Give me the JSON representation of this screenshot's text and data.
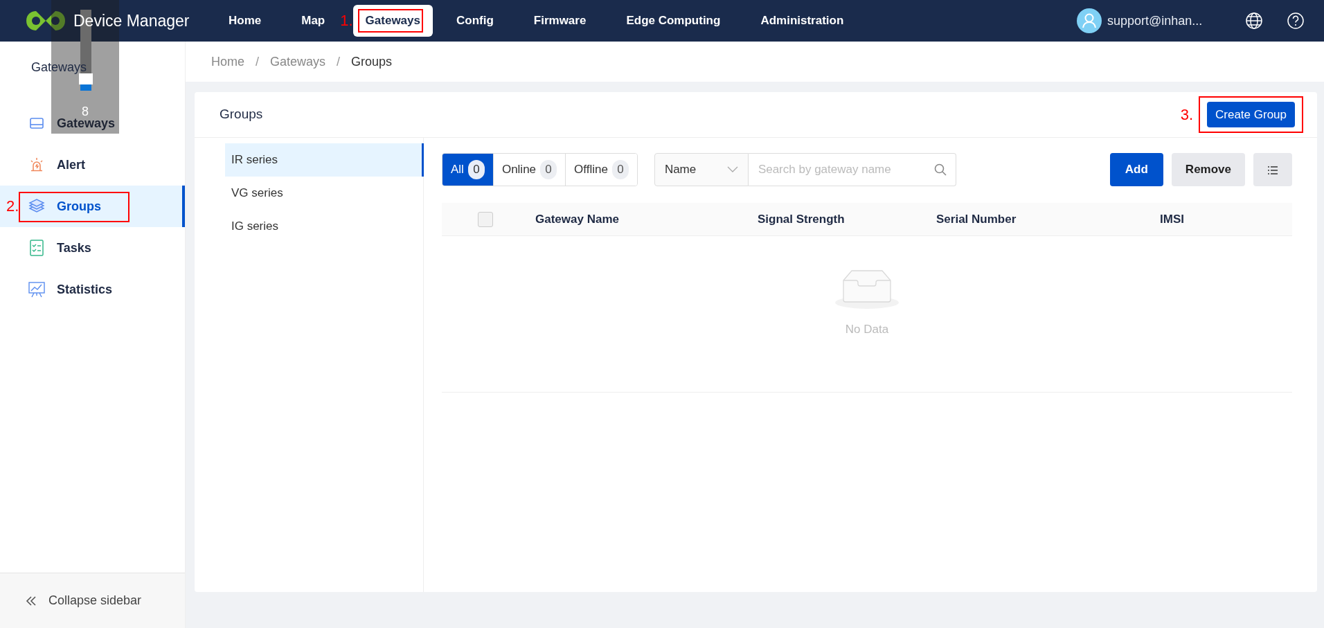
{
  "app": {
    "title": "Device Manager"
  },
  "nav": [
    {
      "label": "Home",
      "selected": false
    },
    {
      "label": "Map",
      "selected": false
    },
    {
      "label": "Gateways",
      "selected": true,
      "annotation": "1."
    },
    {
      "label": "Config",
      "selected": false
    },
    {
      "label": "Firmware",
      "selected": false
    },
    {
      "label": "Edge Computing",
      "selected": false
    },
    {
      "label": "Administration",
      "selected": false
    }
  ],
  "user": {
    "email": "support@inhan..."
  },
  "sidebar": {
    "heading": "Gateways",
    "items": [
      {
        "label": "Gateways",
        "kind": "gateway",
        "selected": false
      },
      {
        "label": "Alert",
        "kind": "alert",
        "selected": false
      },
      {
        "label": "Groups",
        "kind": "layers",
        "selected": true,
        "annotation": "2."
      },
      {
        "label": "Tasks",
        "kind": "tasks",
        "selected": false
      },
      {
        "label": "Statistics",
        "kind": "statistics",
        "selected": false
      }
    ],
    "collapse": "Collapse sidebar"
  },
  "breadcrumb": {
    "separator": "/",
    "items": [
      "Home",
      "Gateways",
      "Groups"
    ]
  },
  "card": {
    "title": "Groups",
    "create_button": "Create Group",
    "create_annotation": "3."
  },
  "groups": [
    {
      "label": "IR series",
      "selected": true
    },
    {
      "label": "VG series",
      "selected": false
    },
    {
      "label": "IG series",
      "selected": false
    }
  ],
  "filters": [
    {
      "label": "All",
      "count": "0",
      "selected": true
    },
    {
      "label": "Online",
      "count": "0",
      "selected": false
    },
    {
      "label": "Offline",
      "count": "0",
      "selected": false
    }
  ],
  "search": {
    "field": "Name",
    "placeholder": "Search by gateway name"
  },
  "actions": [
    {
      "label": "Add",
      "kind": "primary"
    },
    {
      "label": "Remove",
      "kind": "secondary"
    },
    {
      "kind": "list"
    }
  ],
  "table": {
    "select_all": {
      "checked": false
    },
    "columns": [
      "Gateway Name",
      "Signal Strength",
      "Serial Number",
      "IMSI"
    ],
    "empty": "No Data"
  },
  "volume": {
    "level": 0.08,
    "reading": "8"
  }
}
